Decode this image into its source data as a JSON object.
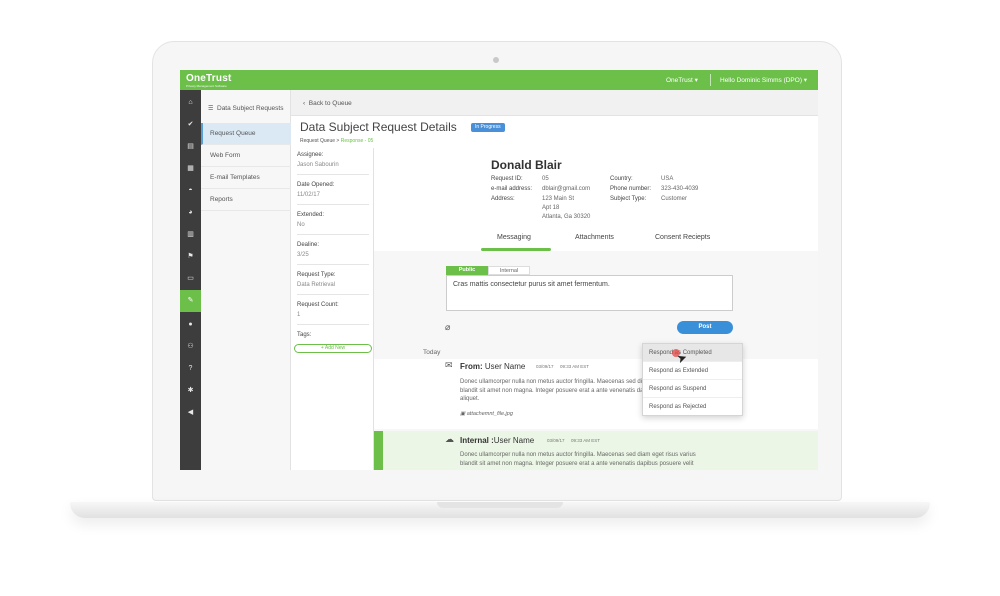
{
  "topbar": {
    "logo": "OneTrust",
    "logo_sub": "Privacy Management Software",
    "org_menu": "OneTrust",
    "user_menu": "Hello Dominic Simms (DPO)",
    "accent_color": "#6cc04a"
  },
  "rail": {
    "icons": [
      "home-icon",
      "check-icon",
      "document-icon",
      "grid-icon",
      "gauge-icon",
      "pie-chart-icon",
      "table-icon",
      "flag-icon",
      "folder-icon",
      "tool-icon",
      "user-icon",
      "users-icon",
      "help-icon",
      "settings-icon",
      "megaphone-icon"
    ]
  },
  "sidebar": {
    "title": "Data Subject Requests",
    "items": [
      {
        "label": "Request Queue"
      },
      {
        "label": "Web Form"
      },
      {
        "label": "E-mail Templates"
      },
      {
        "label": "Reports"
      }
    ]
  },
  "header": {
    "back_label": "Back to Queue",
    "title": "Data Subject Request Details",
    "status": "In Progress",
    "breadcrumb_root": "Request Queue",
    "breadcrumb_sep": ">",
    "breadcrumb_current": "Response - 05"
  },
  "details": {
    "assignee_label": "Assignee:",
    "assignee_value": "Jason Sabourin",
    "date_opened_label": "Date Opened:",
    "date_opened_value": "11/02/17",
    "extended_label": "Extended:",
    "extended_value": "No",
    "deadline_label": "Dealine:",
    "deadline_value": "3/25",
    "request_type_label": "Request Type:",
    "request_type_value": "Data Retrieval",
    "request_count_label": "Request Count:",
    "request_count_value": "1",
    "tags_label": "Tags:",
    "add_new_label": "+ Add New"
  },
  "requester": {
    "name": "Donald Blair",
    "request_id_label": "Request ID:",
    "request_id": "05",
    "email_label": "e-mail address:",
    "email": "dblair@gmail.com",
    "address_label": "Address:",
    "address_line1": "123 Main St",
    "address_line2": "Apt 18",
    "address_line3": "Atlanta, Ga 30320",
    "country_label": "Country:",
    "country": "USA",
    "phone_label": "Phone number:",
    "phone": "323-430-4039",
    "subject_type_label": "Subject Type:",
    "subject_type": "Customer"
  },
  "tabs": [
    {
      "label": "Messaging",
      "active": true
    },
    {
      "label": "Attachments",
      "active": false
    },
    {
      "label": "Consent Reciepts",
      "active": false
    }
  ],
  "composer": {
    "public_label": "Public",
    "internal_label": "Internal",
    "message": "Cras mattis consectetur purus sit amet fermentum.",
    "post_label": "Post"
  },
  "dropdown": {
    "items": [
      {
        "label": "Respond as Completed",
        "hovered": true
      },
      {
        "label": "Respond as Extended",
        "hovered": false
      },
      {
        "label": "Respond as Suspend",
        "hovered": false
      },
      {
        "label": "Respond as Rejected",
        "hovered": false
      }
    ]
  },
  "timeline": {
    "day_label": "Today",
    "messages": [
      {
        "from_prefix": "From:",
        "from_name": "User Name",
        "date": "03/09/17",
        "time": "09:33 AM EST",
        "line1": "Donec ullamcorper nulla non metus auctor fringilla. Maecenas sed diam eget risus varius",
        "line2": "blandit sit amet non magna. Integer posuere erat a ante venenatis dapibus posuere velit",
        "line3": "aliquet.",
        "attachment": "attachemnt_file.jpg"
      },
      {
        "from_prefix": "Internal :",
        "from_name": "User Name",
        "date": "03/09/17",
        "time": "09:33 AM EST",
        "line1": "Donec ullamcorper nulla non metus auctor fringilla. Maecenas sed diam eget risus varius",
        "line2": "blandit sit amet non magna. Integer posuere erat a ante venenatis dapibus posuere velit"
      }
    ]
  }
}
